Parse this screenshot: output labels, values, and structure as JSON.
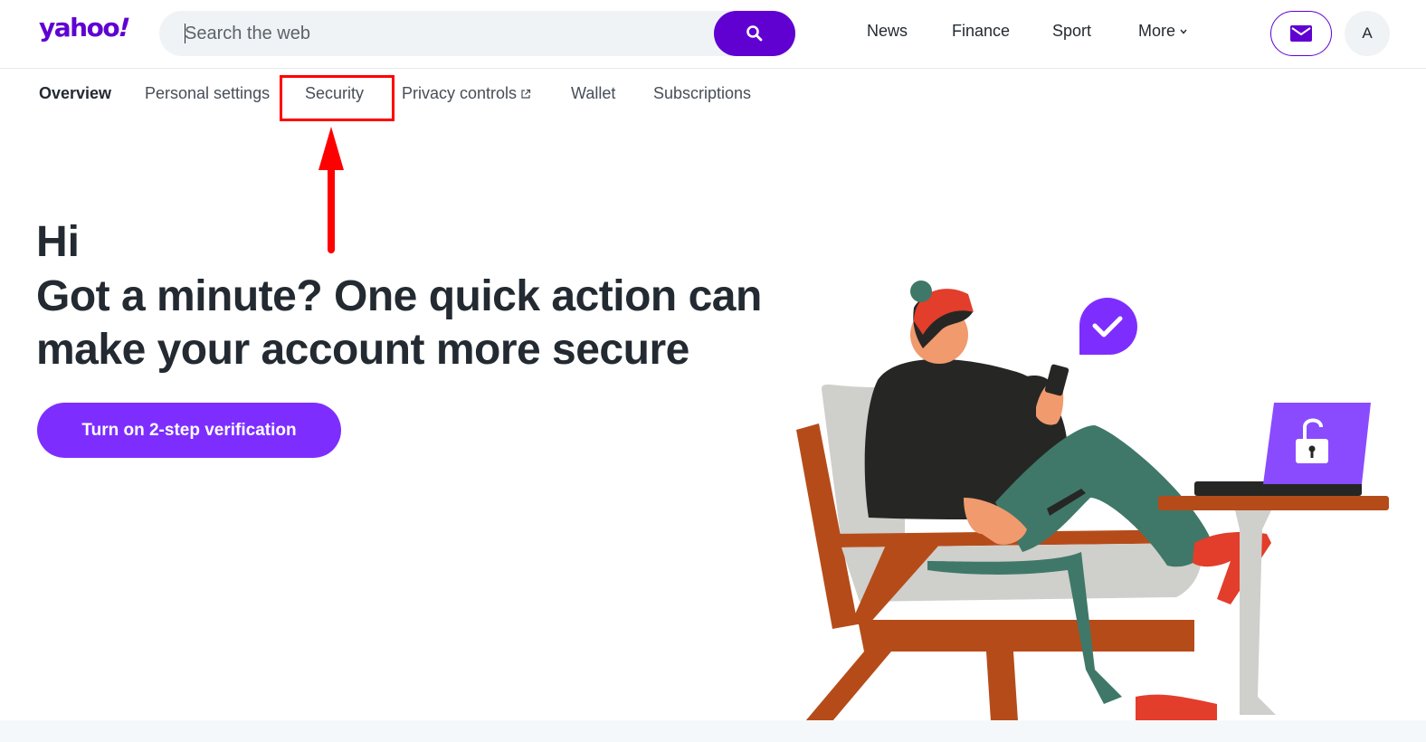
{
  "header": {
    "logo_text": "yahoo",
    "logo_bang": "!",
    "search_placeholder": "Search the web",
    "nav": [
      "News",
      "Finance",
      "Sport",
      "More"
    ],
    "avatar_initial": "A"
  },
  "subnav": {
    "items": [
      "Overview",
      "Personal settings",
      "Security",
      "Privacy controls",
      "Wallet",
      "Subscriptions"
    ],
    "active": "Overview"
  },
  "hero": {
    "greeting": "Hi",
    "message": "Got a minute? One quick action can make your account more secure",
    "cta_label": "Turn on 2-step verification"
  },
  "colors": {
    "brand": "#6001d2",
    "cta": "#7d2eff",
    "annotation": "#ff0000"
  },
  "icons": [
    "search-icon",
    "chevron-down-icon",
    "mail-icon",
    "external-link-icon",
    "arrow-up-annotation",
    "checkmark-badge-icon",
    "padlock-icon"
  ]
}
